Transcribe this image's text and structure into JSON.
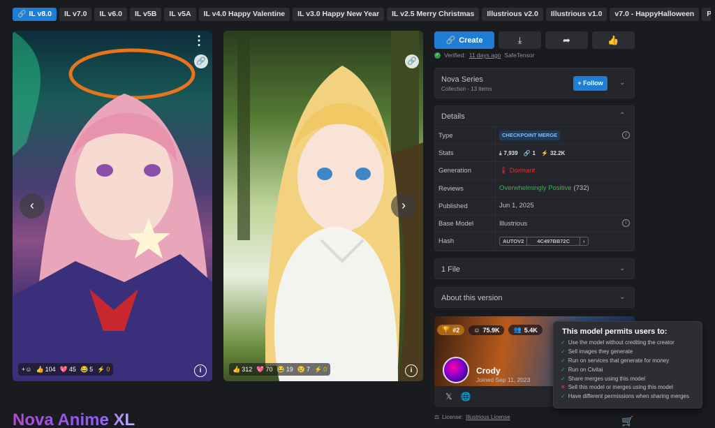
{
  "tabs": [
    {
      "label": "IL v8.0",
      "active": true
    },
    {
      "label": "IL v7.0"
    },
    {
      "label": "IL v6.0"
    },
    {
      "label": "IL v5B"
    },
    {
      "label": "IL v5A"
    },
    {
      "label": "IL v4.0 Happy Valentine"
    },
    {
      "label": "IL v3.0 Happy New Year"
    },
    {
      "label": "IL v2.5 Merry Christmas"
    },
    {
      "label": "Illustrious v2.0"
    },
    {
      "label": "Illustrious v1.0"
    },
    {
      "label": "v7.0 - HappyHalloween"
    },
    {
      "label": "Po"
    }
  ],
  "gallery": {
    "card1": {
      "likes": "104",
      "hearts": "45",
      "laughs": "5",
      "tips": "0"
    },
    "card2": {
      "likes": "312",
      "hearts": "70",
      "laughs": "19",
      "cries": "7",
      "tips": "0"
    }
  },
  "model_title": "Nova Anime XL",
  "actions": {
    "create_label": "Create"
  },
  "verified": {
    "label": "Verified:",
    "when": "11 days ago",
    "format": "SafeTensor"
  },
  "series": {
    "title": "Nova Series",
    "subtitle": "Collection - 13 items",
    "follow_label": "Follow"
  },
  "details": {
    "title": "Details",
    "type_key": "Type",
    "type_val": "CHECKPOINT MERGE",
    "stats_key": "Stats",
    "downloads": "7,939",
    "links": "1",
    "generations": "32.2K",
    "generation_key": "Generation",
    "generation_val": "Dormant",
    "reviews_key": "Reviews",
    "reviews_val": "Overwhelmingly Positive",
    "reviews_count": "(732)",
    "published_key": "Published",
    "published_val": "Jun 1, 2025",
    "base_key": "Base Model",
    "base_val": "Illustrious",
    "hash_key": "Hash",
    "hash_type": "AUTOV2",
    "hash_val": "4C497BB72C"
  },
  "files": {
    "label": "1 File"
  },
  "about": {
    "label": "About this version"
  },
  "creator": {
    "rank": "#2",
    "stat1": "75.9K",
    "stat2": "5.4K",
    "name": "Crody",
    "joined": "Joined Sep 11, 2023"
  },
  "license": {
    "label": "License:",
    "link": "Illustrious License"
  },
  "permissions": {
    "title": "This model permits users to:",
    "items": [
      {
        "text": "Use the model without crediting the creator",
        "ok": true
      },
      {
        "text": "Sell images they generate",
        "ok": true
      },
      {
        "text": "Run on services that generate for money",
        "ok": true
      },
      {
        "text": "Run on Civitai",
        "ok": true
      },
      {
        "text": "Share merges using this model",
        "ok": true
      },
      {
        "text": "Sell this model or merges using this model",
        "ok": false
      },
      {
        "text": "Have different permissions when sharing merges",
        "ok": true
      }
    ]
  },
  "colors": {
    "accent": "#1c7ed6",
    "background": "#1a1b1e",
    "panel": "#25262b"
  }
}
